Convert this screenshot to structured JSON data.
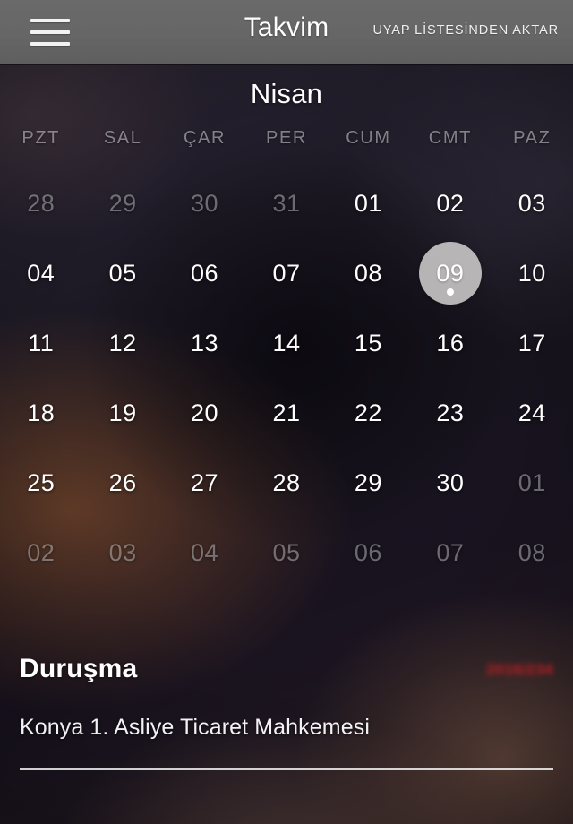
{
  "topbar": {
    "menu_icon": "hamburger-menu-icon",
    "title": "Takvim",
    "action_label": "UYAP LİSTESİNDEN AKTAR"
  },
  "calendar": {
    "month": "Nisan",
    "weekdays": [
      "PZT",
      "SAL",
      "ÇAR",
      "PER",
      "CUM",
      "CMT",
      "PAZ"
    ],
    "selected_day": "09",
    "days": [
      {
        "label": "28",
        "muted": true,
        "selected": false,
        "has_event": false
      },
      {
        "label": "29",
        "muted": true,
        "selected": false,
        "has_event": false
      },
      {
        "label": "30",
        "muted": true,
        "selected": false,
        "has_event": false
      },
      {
        "label": "31",
        "muted": true,
        "selected": false,
        "has_event": false
      },
      {
        "label": "01",
        "muted": false,
        "selected": false,
        "has_event": false
      },
      {
        "label": "02",
        "muted": false,
        "selected": false,
        "has_event": false
      },
      {
        "label": "03",
        "muted": false,
        "selected": false,
        "has_event": false
      },
      {
        "label": "04",
        "muted": false,
        "selected": false,
        "has_event": false
      },
      {
        "label": "05",
        "muted": false,
        "selected": false,
        "has_event": false
      },
      {
        "label": "06",
        "muted": false,
        "selected": false,
        "has_event": false
      },
      {
        "label": "07",
        "muted": false,
        "selected": false,
        "has_event": false
      },
      {
        "label": "08",
        "muted": false,
        "selected": false,
        "has_event": false
      },
      {
        "label": "09",
        "muted": false,
        "selected": true,
        "has_event": true
      },
      {
        "label": "10",
        "muted": false,
        "selected": false,
        "has_event": false
      },
      {
        "label": "11",
        "muted": false,
        "selected": false,
        "has_event": false
      },
      {
        "label": "12",
        "muted": false,
        "selected": false,
        "has_event": false
      },
      {
        "label": "13",
        "muted": false,
        "selected": false,
        "has_event": false
      },
      {
        "label": "14",
        "muted": false,
        "selected": false,
        "has_event": false
      },
      {
        "label": "15",
        "muted": false,
        "selected": false,
        "has_event": false
      },
      {
        "label": "16",
        "muted": false,
        "selected": false,
        "has_event": false
      },
      {
        "label": "17",
        "muted": false,
        "selected": false,
        "has_event": false
      },
      {
        "label": "18",
        "muted": false,
        "selected": false,
        "has_event": false
      },
      {
        "label": "19",
        "muted": false,
        "selected": false,
        "has_event": false
      },
      {
        "label": "20",
        "muted": false,
        "selected": false,
        "has_event": false
      },
      {
        "label": "21",
        "muted": false,
        "selected": false,
        "has_event": false
      },
      {
        "label": "22",
        "muted": false,
        "selected": false,
        "has_event": false
      },
      {
        "label": "23",
        "muted": false,
        "selected": false,
        "has_event": false
      },
      {
        "label": "24",
        "muted": false,
        "selected": false,
        "has_event": false
      },
      {
        "label": "25",
        "muted": false,
        "selected": false,
        "has_event": false
      },
      {
        "label": "26",
        "muted": false,
        "selected": false,
        "has_event": false
      },
      {
        "label": "27",
        "muted": false,
        "selected": false,
        "has_event": false
      },
      {
        "label": "28",
        "muted": false,
        "selected": false,
        "has_event": false
      },
      {
        "label": "29",
        "muted": false,
        "selected": false,
        "has_event": false
      },
      {
        "label": "30",
        "muted": false,
        "selected": false,
        "has_event": false
      },
      {
        "label": "01",
        "muted": true,
        "selected": false,
        "has_event": false
      },
      {
        "label": "02",
        "muted": true,
        "selected": false,
        "has_event": false
      },
      {
        "label": "03",
        "muted": true,
        "selected": false,
        "has_event": false
      },
      {
        "label": "04",
        "muted": true,
        "selected": false,
        "has_event": false
      },
      {
        "label": "05",
        "muted": true,
        "selected": false,
        "has_event": false
      },
      {
        "label": "06",
        "muted": true,
        "selected": false,
        "has_event": false
      },
      {
        "label": "07",
        "muted": true,
        "selected": false,
        "has_event": false
      },
      {
        "label": "08",
        "muted": true,
        "selected": false,
        "has_event": false
      }
    ]
  },
  "event": {
    "title": "Duruşma",
    "case_number": "2016/234",
    "subtitle": "Konya 1. Asliye Ticaret Mahkemesi"
  },
  "colors": {
    "topbar_bg": "#666666",
    "selected_circle": "#cdcbcb",
    "case_number_red": "#cc1f22",
    "day_text": "#ffffff",
    "day_text_muted": "rgba(232,230,236,0.42)"
  }
}
